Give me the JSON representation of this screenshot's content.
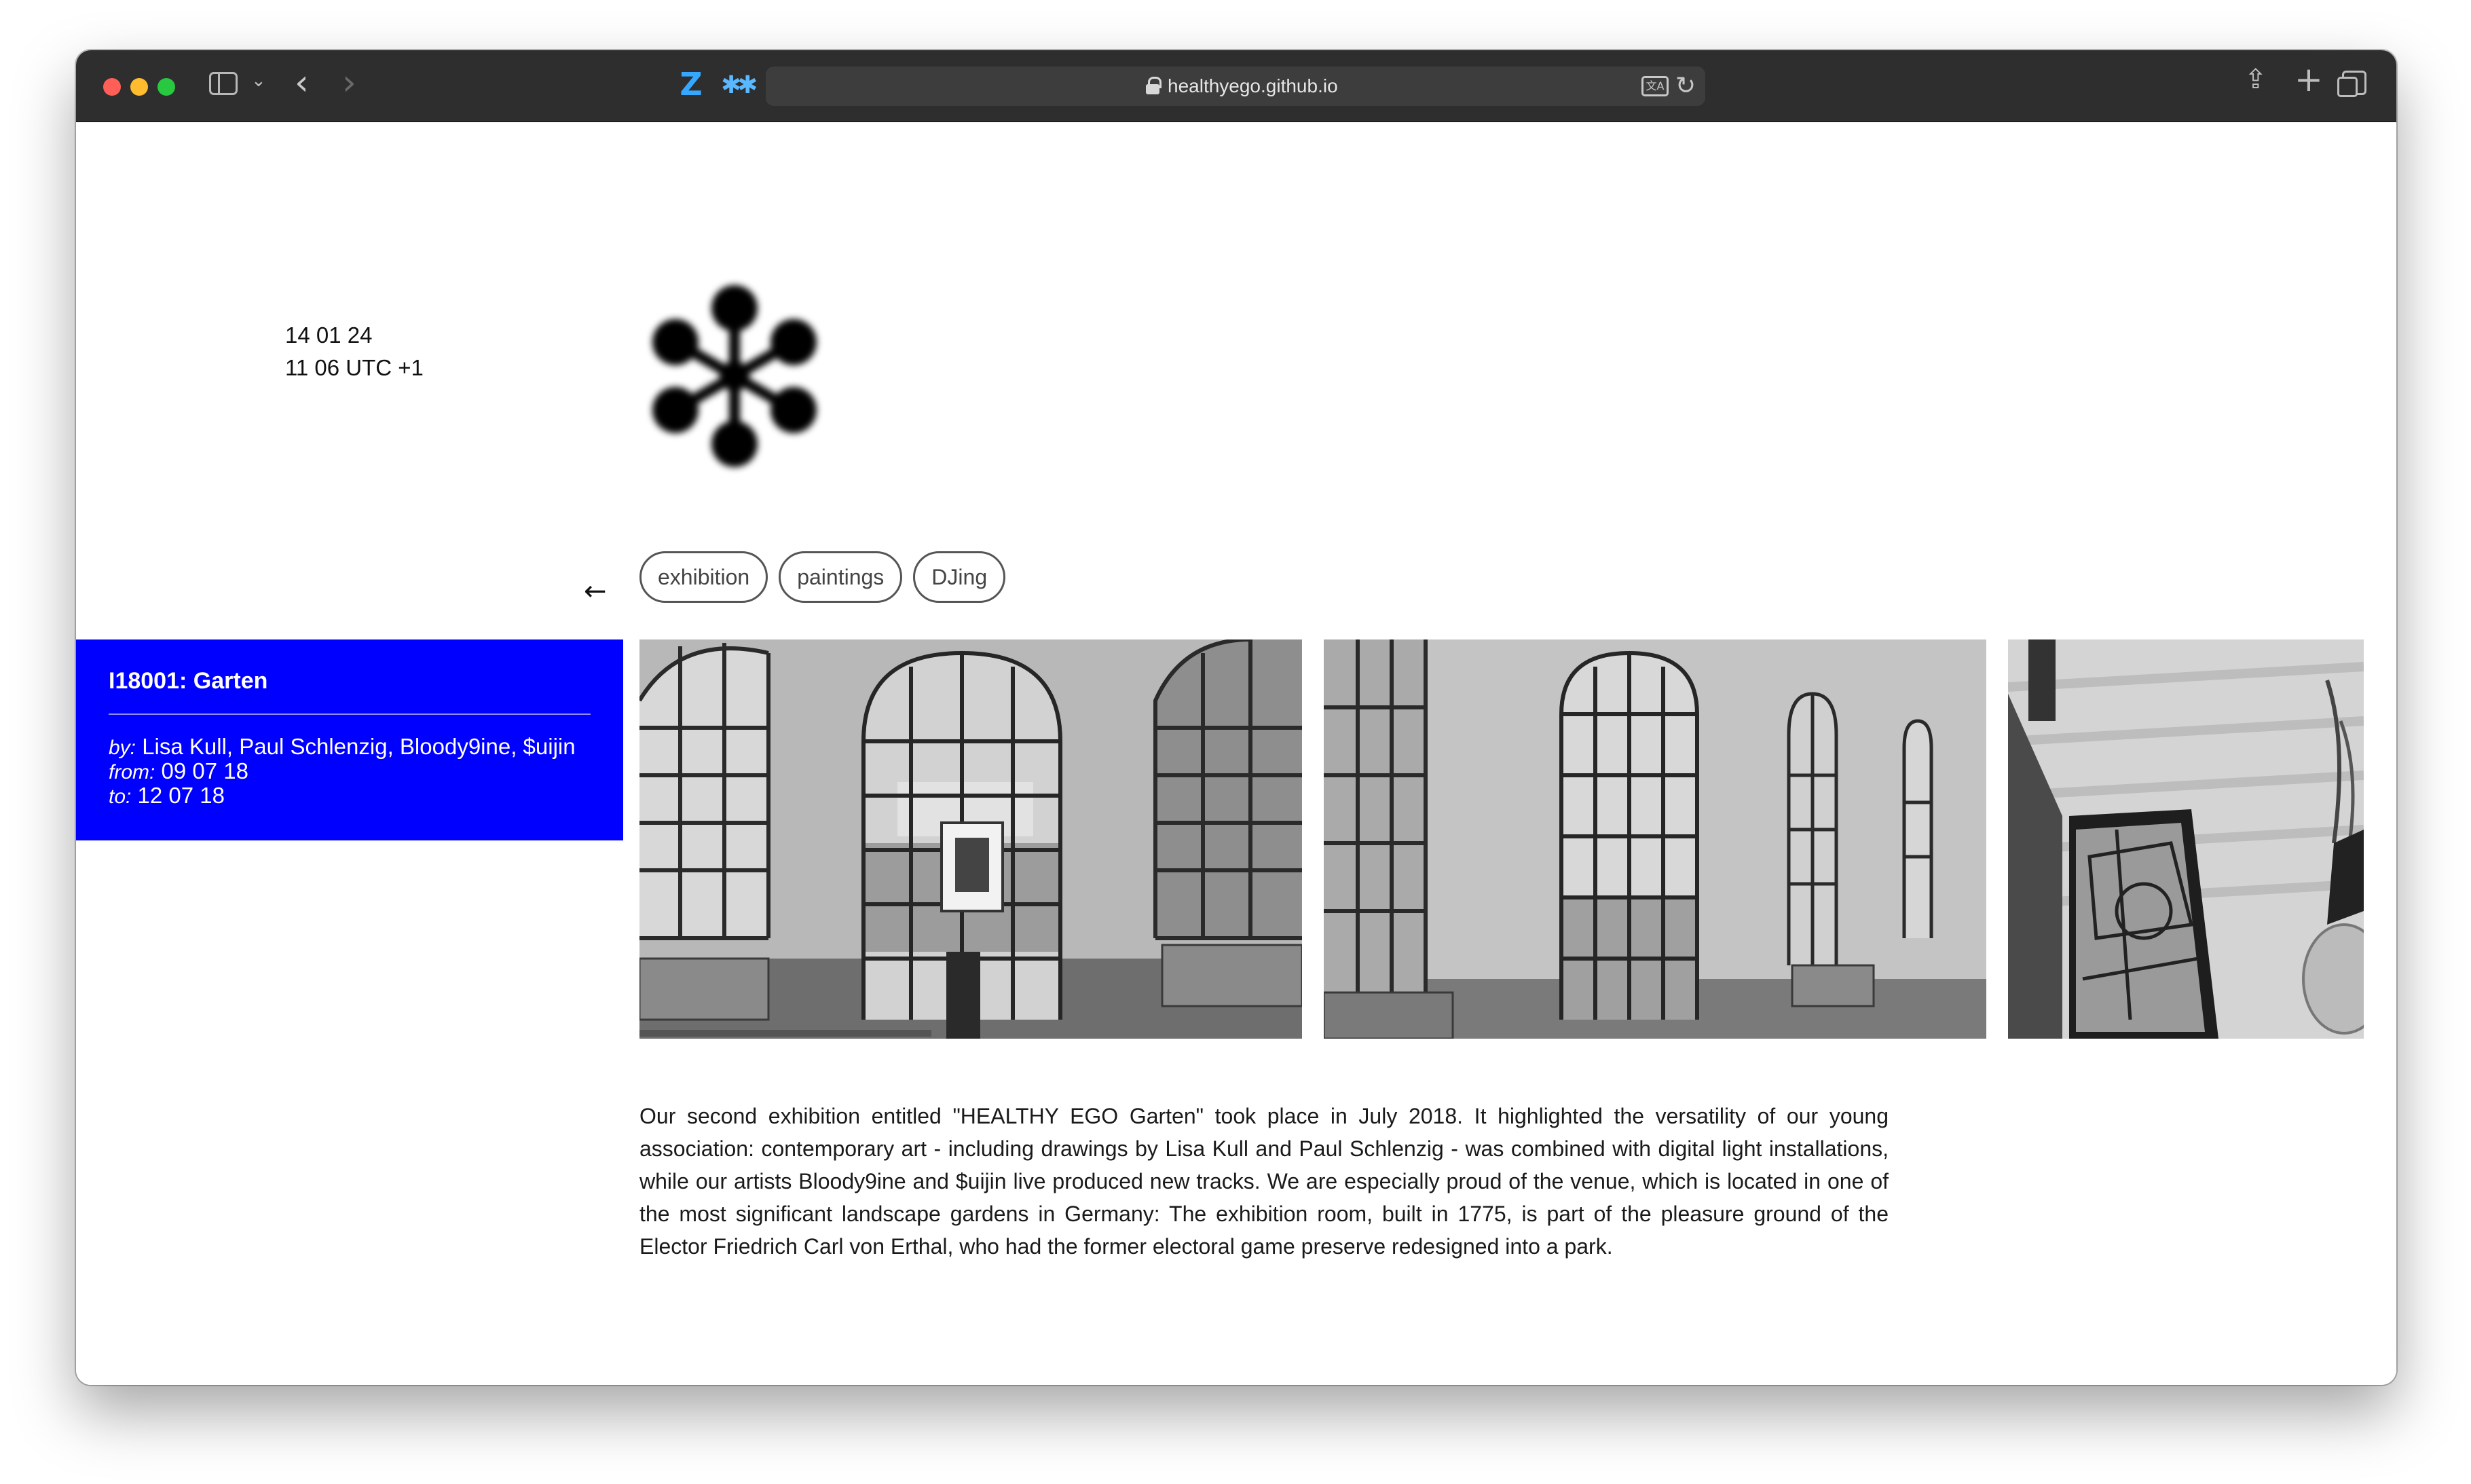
{
  "browser": {
    "url": "healthyego.github.io",
    "extension_z": "Z",
    "extension_star": "✱✱"
  },
  "page": {
    "date": "14 01 24",
    "time": "11 06 UTC +1",
    "back_arrow": "←",
    "tags": [
      "exhibition",
      "paintings",
      "DJing"
    ],
    "info": {
      "id": "I18001",
      "title": "Garten",
      "by_label": "by:",
      "by": "Lisa Kull, Paul Schlenzig, Bloody9ine, $uijin",
      "from_label": "from:",
      "from": "09 07 18",
      "to_label": "to:",
      "to": "12 07 18",
      "accent": "#0000ff"
    },
    "description": "Our second exhibition entitled \"HEALTHY EGO Garten\" took place in July 2018. It highlighted the versatility of our young association: contemporary art - including drawings by Lisa Kull and Paul Schlenzig - was combined with digital light installations, while our artists Bloody9ine and $uijin live produced new tracks. We are especially proud of the venue, which is located in one of the most significant landscape gardens in Germany: The exhibition room, built in 1775, is part of the pleasure ground of the Elector Friedrich Carl von Erthal, who had the former electoral game preserve redesigned into a park."
  }
}
